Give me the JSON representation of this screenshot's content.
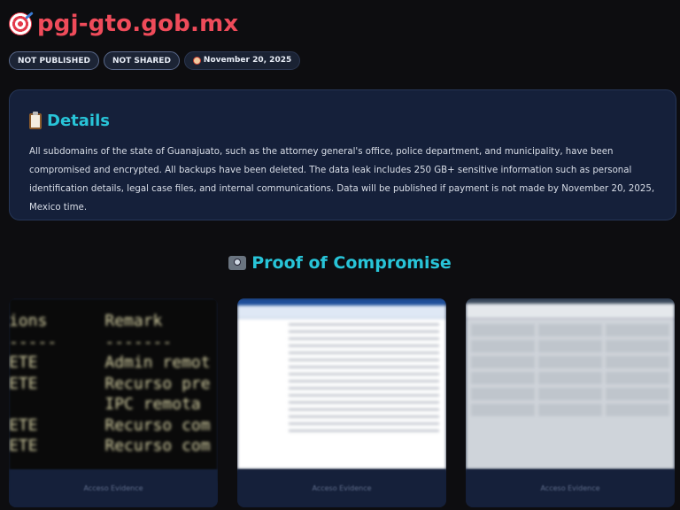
{
  "header": {
    "title": "pgj-gto.gob.mx",
    "icon": "target-icon"
  },
  "badges": [
    {
      "label": "NOT PUBLISHED"
    },
    {
      "label": "NOT SHARED"
    },
    {
      "label": "November 20, 2025",
      "icon": "alarm-clock-icon"
    }
  ],
  "details": {
    "icon": "clipboard-icon",
    "title": "Details",
    "text": "All subdomains of the state of Guanajuato, such as the attorney general's office, police department, and municipality, have been compromised and encrypted. All backups have been deleted. The data leak includes 250 GB+ sensitive information such as personal identification details, legal case files, and internal communications. Data will be published if payment is not made by November 20, 2025, Mexico time."
  },
  "proof": {
    "icon": "camera-icon",
    "title": "Proof of Compromise",
    "cards": [
      {
        "caption": "Acceso Evidence",
        "terminal_lines": [
          "ions      Remark",
          "-----     -------",
          "ETE       Admin remot",
          "ETE       Recurso pre",
          "          IPC remota",
          "ETE       Recurso com",
          "ETE       Recurso com"
        ]
      },
      {
        "caption": "Acceso Evidence"
      },
      {
        "caption": "Acceso Evidence"
      }
    ]
  },
  "colors": {
    "background": "#0d0d10",
    "title_red": "#ef4b5a",
    "accent_cyan": "#28c4d8",
    "card_navy": "#15203a"
  }
}
